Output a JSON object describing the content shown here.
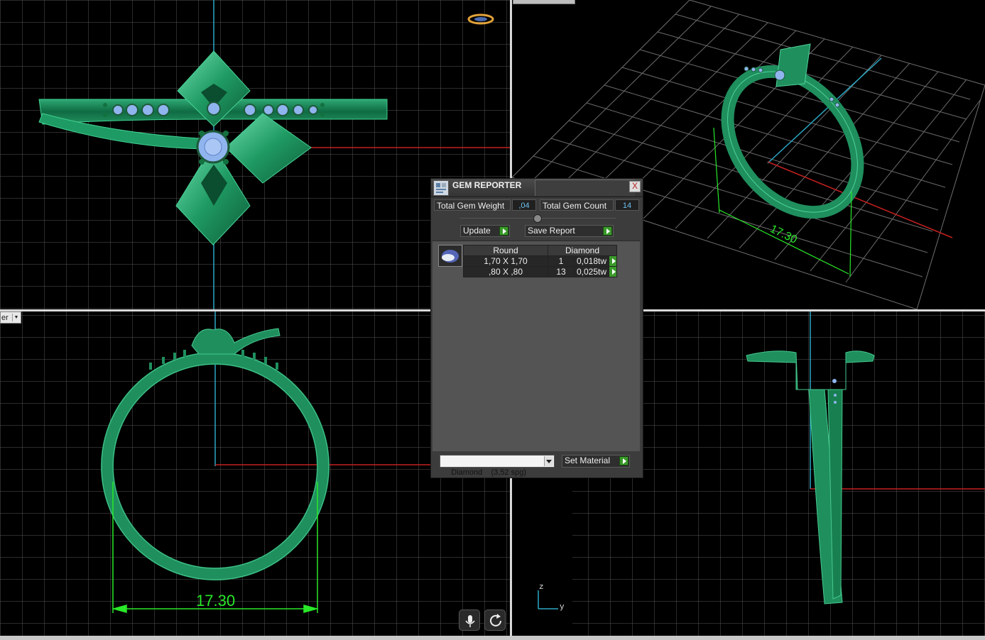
{
  "viewports": {
    "front_dimension": "17.30",
    "perspective_dimension": "17.30",
    "view_combo_text": "er",
    "axis_indicator": {
      "z": "z",
      "y": "y"
    }
  },
  "gem_reporter": {
    "title": "GEM REPORTER",
    "close_label": "X",
    "total_gem_weight_label": "Total Gem Weight",
    "total_gem_weight_value": ",04",
    "total_gem_count_label": "Total Gem Count",
    "total_gem_count_value": "14",
    "update_label": "Update",
    "save_report_label": "Save Report",
    "table": {
      "headers": [
        "Round",
        "Diamond"
      ],
      "rows": [
        {
          "size": "1,70 X 1,70",
          "count": "1",
          "weight": "0,018tw"
        },
        {
          "size": ",80 X ,80",
          "count": "13",
          "weight": "0,025tw"
        }
      ]
    },
    "material_select": "Diamond    (3,52 spg)",
    "set_material_label": "Set Material"
  },
  "icons": [
    "gem-reporter-logo-icon",
    "gem-icon",
    "microphone-icon",
    "refresh-icon",
    "ring-thumbnail-icon"
  ],
  "colors": {
    "model_green": "#1f8f5e",
    "grid": "#585858",
    "dimension": "#29e829",
    "axis_x": "#c42020",
    "axis_y": "#2aa8c4",
    "gem_blue": "#8fb4ee"
  }
}
